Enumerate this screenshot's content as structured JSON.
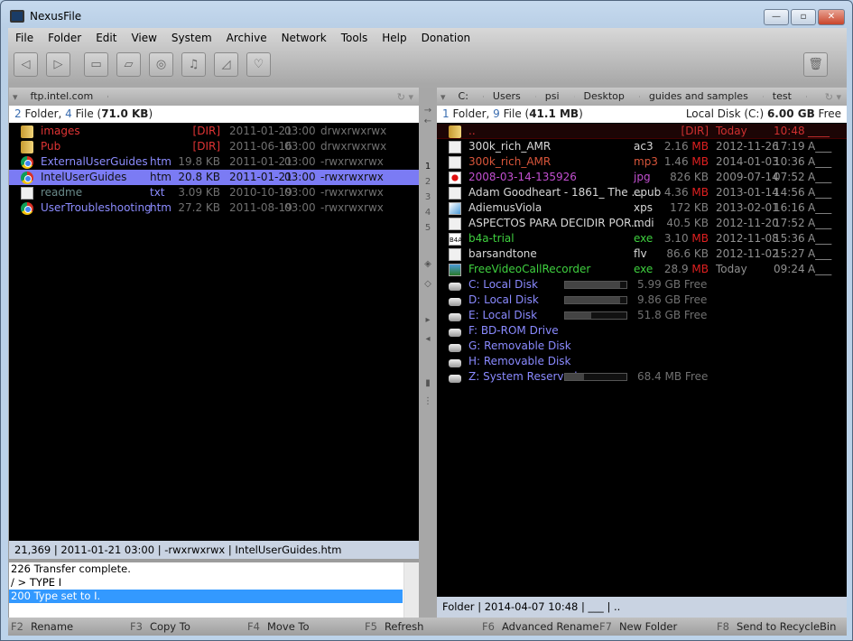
{
  "window": {
    "title": "NexusFile"
  },
  "menu": [
    "File",
    "Folder",
    "Edit",
    "View",
    "System",
    "Archive",
    "Network",
    "Tools",
    "Help",
    "Donation"
  ],
  "toolbar": {
    "icons": [
      "back-icon",
      "forward-icon",
      "window-icon",
      "folder-icon",
      "camera-icon",
      "music-icon",
      "archive-icon",
      "favorites-icon"
    ],
    "right": "recycle-bin-icon"
  },
  "left": {
    "breadcrumb": [
      "ftp.intel.com"
    ],
    "info": {
      "folders": "2",
      "folder_label": " Folder, ",
      "files": "4",
      "file_label": " File (",
      "size": "71.0 KB",
      "close": ")"
    },
    "rows": [
      {
        "icon": "folder",
        "name": "images",
        "ext": "",
        "size": "[DIR]",
        "date": "2011-01-21",
        "time": "03:00",
        "attr": "drwxrwxrwx",
        "color": "#e03434"
      },
      {
        "icon": "folder",
        "name": "Pub",
        "ext": "",
        "size": "[DIR]",
        "date": "2011-06-16",
        "time": "03:00",
        "attr": "drwxrwxrwx",
        "color": "#e03434"
      },
      {
        "icon": "chrome",
        "name": "ExternalUserGuides",
        "ext": "htm",
        "size": "19.8 KB",
        "date": "2011-01-21",
        "time": "03:00",
        "attr": "-rwxrwxrwx",
        "color": "#8c8cff"
      },
      {
        "icon": "chrome",
        "name": "IntelUserGuides",
        "ext": "htm",
        "size": "20.8 KB",
        "date": "2011-01-21",
        "time": "03:00",
        "attr": "-rwxrwxrwx",
        "color": "#8c8cff",
        "selected": true
      },
      {
        "icon": "doc",
        "name": "readme",
        "ext": "txt",
        "size": "3.09 KB",
        "date": "2010-10-19",
        "time": "03:00",
        "attr": "-rwxrwxrwx",
        "color": "#6a8a8a"
      },
      {
        "icon": "chrome",
        "name": "UserTroubleshooting",
        "ext": "htm",
        "size": "27.2 KB",
        "date": "2011-08-19",
        "time": "03:00",
        "attr": "-rwxrwxrwx",
        "color": "#8c8cff"
      }
    ],
    "status": "21,369 | 2011-01-21 03:00 | -rwxrwxrwx | IntelUserGuides.htm",
    "log": [
      "226 Transfer complete.",
      "/ > TYPE I",
      "200 Type set to I."
    ]
  },
  "middle": {
    "tabs": [
      "1",
      "2",
      "3",
      "4",
      "5"
    ]
  },
  "right": {
    "breadcrumb": [
      "C:",
      "Users",
      "psi",
      "Desktop",
      "guides and samples",
      "test"
    ],
    "info": {
      "folders": "1",
      "folder_label": " Folder, ",
      "files": "9",
      "file_label": " File (",
      "size": "41.1 MB",
      "close": ")",
      "disk": "Local Disk (C:) ",
      "free": "6.00 GB",
      "free_label": " Free"
    },
    "rows": [
      {
        "icon": "folder",
        "name": "..",
        "ext": "",
        "size": "[DIR]",
        "unit": "",
        "date": "Today",
        "time": "10:48",
        "attr": "____",
        "color": "#d03030"
      },
      {
        "icon": "doc",
        "name": "300k_rich_AMR",
        "ext": "ac3",
        "size": "2.16 ",
        "unit": "MB",
        "date": "2012-11-26",
        "time": "17:19",
        "attr": "A___",
        "color": "#d8d8d8"
      },
      {
        "icon": "doc",
        "name": "300k_rich_AMR",
        "ext": "mp3",
        "size": "1.46 ",
        "unit": "MB",
        "date": "2014-01-03",
        "time": "10:36",
        "attr": "A___",
        "color": "#d8553a"
      },
      {
        "icon": "img",
        "name": "2008-03-14-135926",
        "ext": "jpg",
        "size": "826 KB",
        "unit": "",
        "date": "2009-07-14",
        "time": "07:52",
        "attr": "A___",
        "color": "#c24fd0"
      },
      {
        "icon": "doc",
        "name": "Adam Goodheart - 1861_ The ...",
        "ext": "epub",
        "size": "4.36 ",
        "unit": "MB",
        "date": "2013-01-14",
        "time": "14:56",
        "attr": "A___",
        "color": "#d8d8d8"
      },
      {
        "icon": "xps",
        "name": "AdiemusViola",
        "ext": "xps",
        "size": "172 KB",
        "unit": "",
        "date": "2013-02-01",
        "time": "16:16",
        "attr": "A___",
        "color": "#d8d8d8"
      },
      {
        "icon": "doc",
        "name": "ASPECTOS PARA DECIDIR POR...",
        "ext": "mdi",
        "size": "40.5 KB",
        "unit": "",
        "date": "2012-11-20",
        "time": "17:52",
        "attr": "A___",
        "color": "#d8d8d8"
      },
      {
        "icon": "b4a",
        "name": "b4a-trial",
        "ext": "exe",
        "size": "3.10 ",
        "unit": "MB",
        "date": "2012-11-08",
        "time": "15:36",
        "attr": "A___",
        "color": "#3fd03f"
      },
      {
        "icon": "doc",
        "name": "barsandtone",
        "ext": "flv",
        "size": "86.6 KB",
        "unit": "",
        "date": "2012-11-02",
        "time": "15:27",
        "attr": "A___",
        "color": "#d8d8d8"
      },
      {
        "icon": "app",
        "name": "FreeVideoCallRecorder",
        "ext": "exe",
        "size": "28.9 ",
        "unit": "MB",
        "date": "Today",
        "time": "09:24",
        "attr": "A___",
        "color": "#3fd03f"
      }
    ],
    "drives": [
      {
        "name": "C: Local Disk",
        "free": "5.99 GB Free",
        "used_fraction": 0.9
      },
      {
        "name": "D: Local Disk",
        "free": "9.86 GB Free",
        "used_fraction": 0.9
      },
      {
        "name": "E: Local Disk",
        "free": "51.8 GB Free",
        "used_fraction": 0.43
      },
      {
        "name": "F: BD-ROM Drive",
        "free": ""
      },
      {
        "name": "G: Removable Disk",
        "free": ""
      },
      {
        "name": "H: Removable Disk",
        "free": ""
      },
      {
        "name": "Z: System Reserved",
        "free": "68.4 MB Free",
        "used_fraction": 0.31
      }
    ],
    "status": "Folder | 2014-04-07 10:48 | ___ | .."
  },
  "fkeys": [
    {
      "key": "F2",
      "label": "Rename"
    },
    {
      "key": "F3",
      "label": "Copy To"
    },
    {
      "key": "F4",
      "label": "Move To"
    },
    {
      "key": "F5",
      "label": "Refresh"
    },
    {
      "key": "F6",
      "label": "Advanced Rename"
    },
    {
      "key": "F7",
      "label": "New Folder"
    },
    {
      "key": "F8",
      "label": "Send to RecycleBin"
    }
  ],
  "colors": {
    "size_unit_mb": "#e02020",
    "selection": "#7b7bf4",
    "drive_text": "#8a8aff"
  }
}
